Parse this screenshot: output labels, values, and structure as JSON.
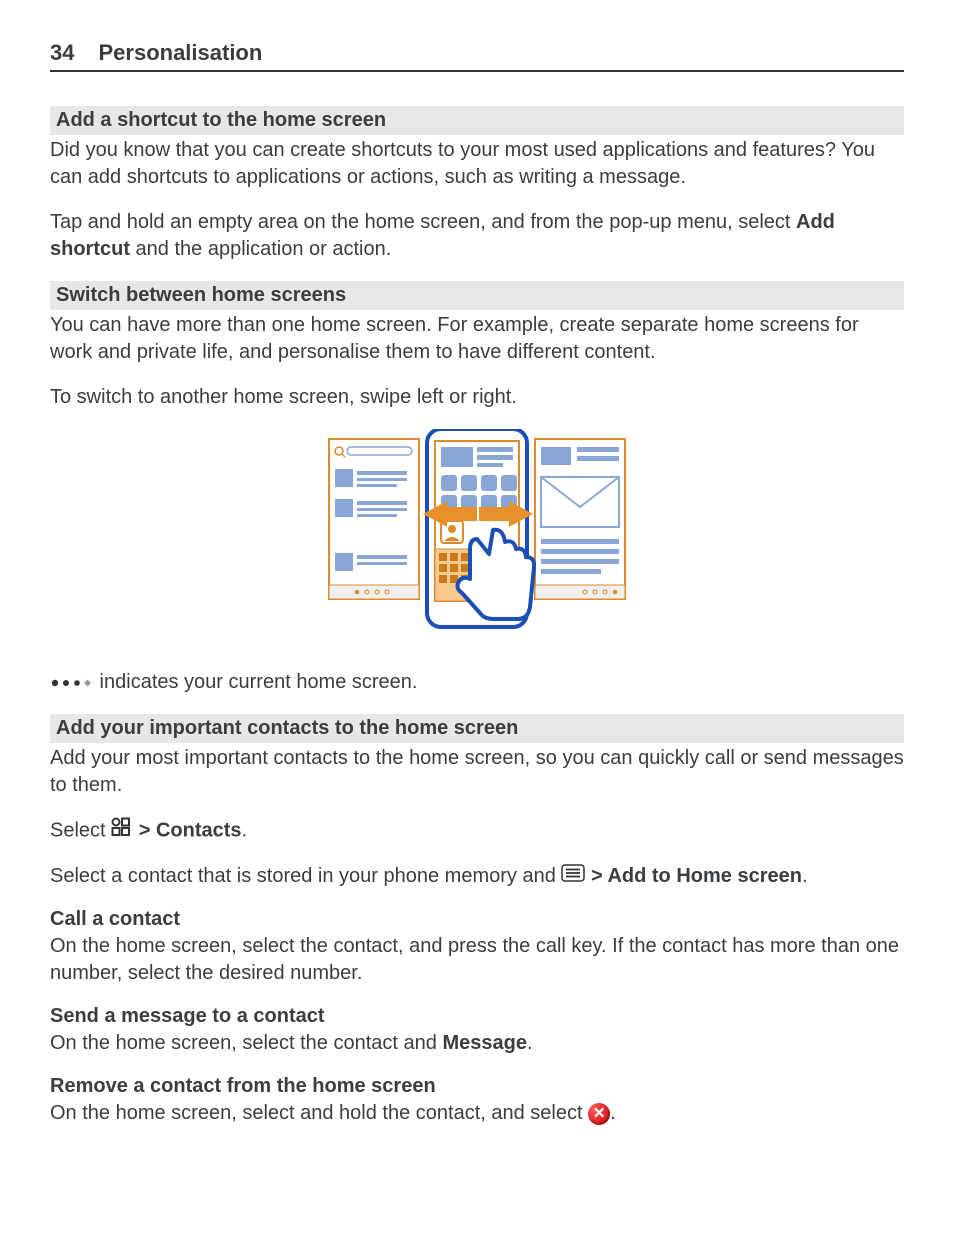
{
  "header": {
    "page_number": "34",
    "title": "Personalisation"
  },
  "sections": {
    "shortcut": {
      "heading": "Add a shortcut to the home screen",
      "p1": "Did you know that you can create shortcuts to your most used applications and features? You can add shortcuts to applications or actions, such as writing a message.",
      "p2a": "Tap and hold an empty area on the home screen, and from the pop-up menu, select ",
      "p2b": "Add shortcut",
      "p2c": " and the application or action."
    },
    "switch": {
      "heading": "Switch between home screens",
      "p1": "You can have more than one home screen. For example, create separate home screens for work and private life, and personalise them to have different content.",
      "p2": "To switch to another home screen, swipe left or right.",
      "caption": " indicates your current home screen."
    },
    "contacts": {
      "heading": "Add your important contacts to the home screen",
      "p1": "Add your most important contacts to the home screen, so you can quickly call or send messages to them.",
      "select_a": "Select ",
      "select_b": " > ",
      "select_c": "Contacts",
      "select_d": ".",
      "mem_a": "Select a contact that is stored in your phone memory and ",
      "mem_b": " > ",
      "mem_c": "Add to Home screen",
      "mem_d": "."
    },
    "call": {
      "heading": "Call a contact",
      "p": "On the home screen, select the contact, and press the call key. If the contact has more than one number, select the desired number."
    },
    "send": {
      "heading": "Send a message to a contact",
      "p_a": "On the home screen, select the contact and ",
      "p_b": "Message",
      "p_c": "."
    },
    "remove": {
      "heading": "Remove a contact from the home screen",
      "p_a": "On the home screen, select and hold the contact, and select ",
      "p_c": "."
    }
  }
}
